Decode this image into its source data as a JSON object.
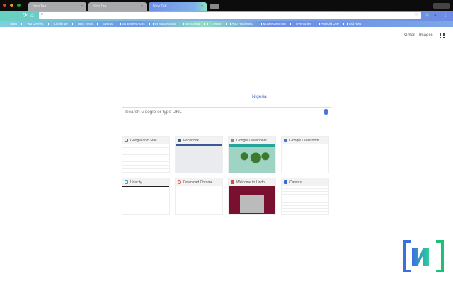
{
  "tabs": [
    {
      "title": "New Tab"
    },
    {
      "title": "New Tab"
    },
    {
      "title": "New Tab",
      "active": true
    }
  ],
  "bookmarks": [
    "Apps",
    "W3 Devfest",
    "Challenge",
    "UDU Tools",
    "Events",
    "Strategies Apps",
    "UI Masterclass",
    "Becoming",
    "- Lesson",
    "App Hardening",
    "Mobile Learning",
    "Inventories",
    "Android One",
    "Old New"
  ],
  "header": {
    "gmail": "Gmail",
    "images": "Images"
  },
  "location": "Nigeria",
  "search": {
    "placeholder": "Search Google or type URL"
  },
  "tiles": [
    {
      "title": "Google.com Mail",
      "icon_color": "#4a6fd6"
    },
    {
      "title": "Facebook",
      "icon_color": "#3b5998"
    },
    {
      "title": "Google Developers",
      "icon_color": "#666666"
    },
    {
      "title": "Google Classroom",
      "icon_color": "#4a6fd6"
    },
    {
      "title": "Udacity",
      "icon_color": "#2fa7d8"
    },
    {
      "title": "Download Chrome",
      "icon_color": "#dd4b39"
    },
    {
      "title": "Welcome to Lindo",
      "icon_color": "#dd4b39"
    },
    {
      "title": "Canvas",
      "icon_color": "#3367d6"
    }
  ],
  "colors": {
    "accent": "#6d8ae6",
    "teal": "#66d1bf"
  }
}
